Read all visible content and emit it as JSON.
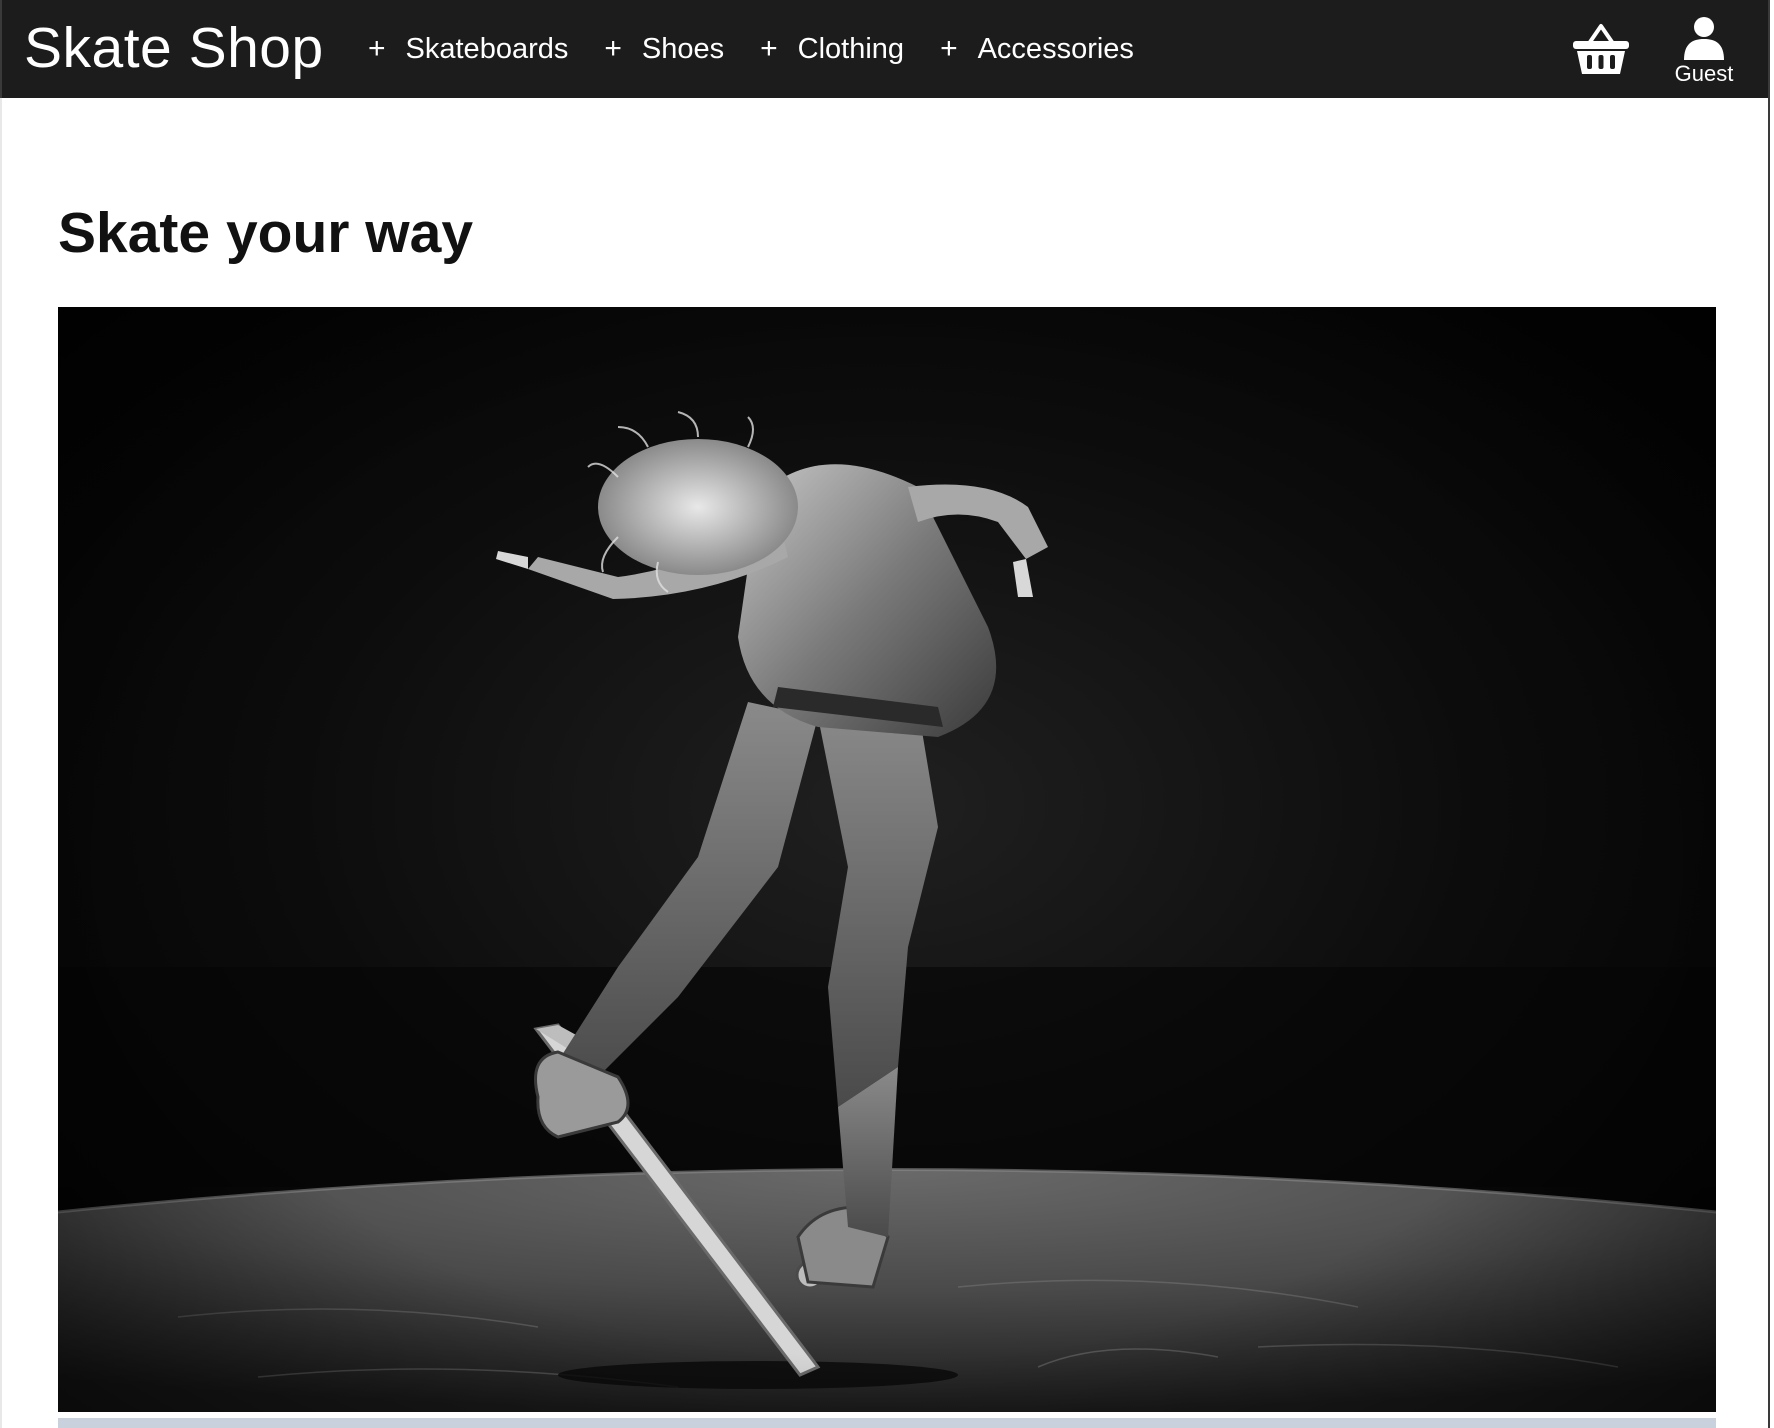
{
  "header": {
    "brand": "Skate Shop",
    "nav": [
      {
        "label": "Skateboards"
      },
      {
        "label": "Shoes"
      },
      {
        "label": "Clothing"
      },
      {
        "label": "Accessories"
      }
    ],
    "nav_prefix": "+",
    "cart_icon": "basket-icon",
    "user_icon": "user-icon",
    "user_label": "Guest"
  },
  "main": {
    "headline": "Skate your way",
    "hero_image": "skateboarder-photo"
  },
  "colors": {
    "topbar": "#1c1c1c",
    "text_light": "#ffffff",
    "headline": "#111111",
    "strip": "#c9d2dc"
  }
}
